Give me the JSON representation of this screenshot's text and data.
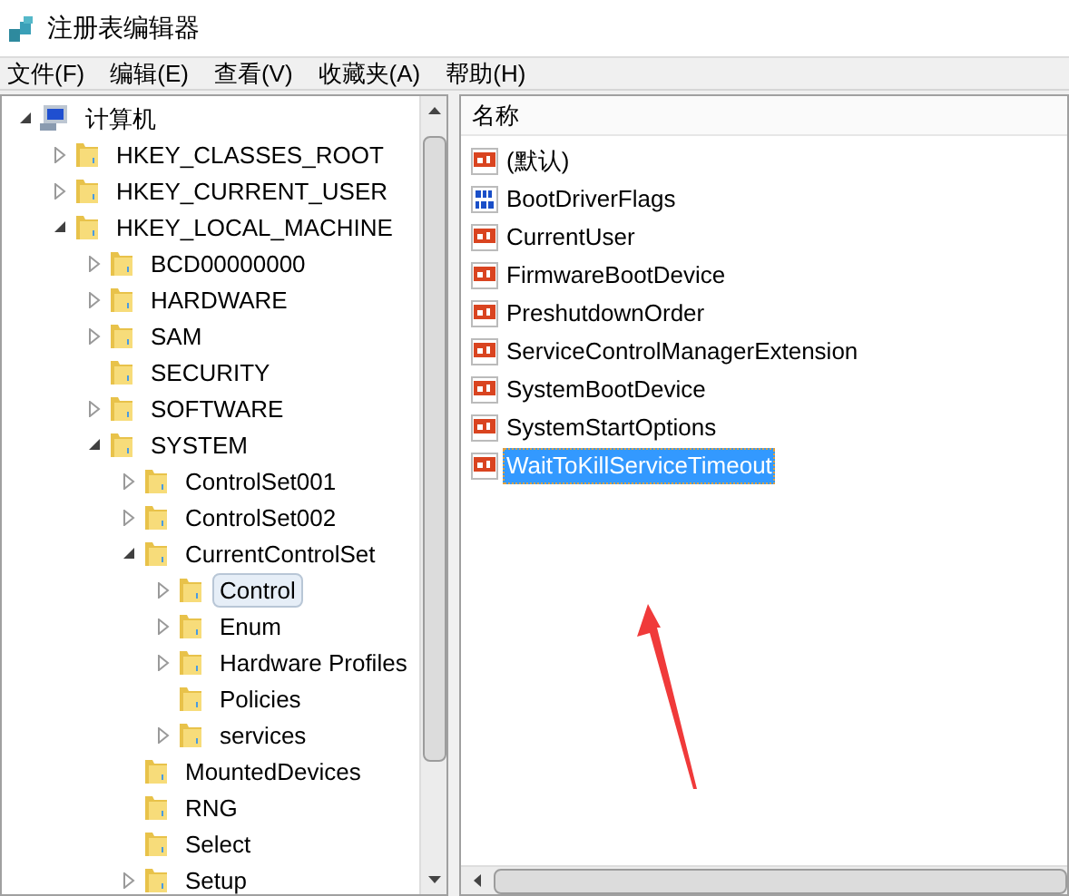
{
  "window": {
    "title": "注册表编辑器"
  },
  "menu": [
    "文件(F)",
    "编辑(E)",
    "查看(V)",
    "收藏夹(A)",
    "帮助(H)"
  ],
  "tree": {
    "label": "计算机",
    "expanded": true,
    "selected": false,
    "children": [
      {
        "label": "HKEY_CLASSES_ROOT",
        "expanded": false,
        "selected": false
      },
      {
        "label": "HKEY_CURRENT_USER",
        "expanded": false,
        "selected": false
      },
      {
        "label": "HKEY_LOCAL_MACHINE",
        "expanded": true,
        "selected": false,
        "children": [
          {
            "label": "BCD00000000",
            "expanded": false,
            "selected": false
          },
          {
            "label": "HARDWARE",
            "expanded": false,
            "selected": false
          },
          {
            "label": "SAM",
            "expanded": false,
            "selected": false
          },
          {
            "label": "SECURITY",
            "selected": false
          },
          {
            "label": "SOFTWARE",
            "expanded": false,
            "selected": false
          },
          {
            "label": "SYSTEM",
            "expanded": true,
            "selected": false,
            "children": [
              {
                "label": "ControlSet001",
                "expanded": false,
                "selected": false
              },
              {
                "label": "ControlSet002",
                "expanded": false,
                "selected": false
              },
              {
                "label": "CurrentControlSet",
                "expanded": true,
                "selected": false,
                "children": [
                  {
                    "label": "Control",
                    "expanded": false,
                    "selected": true
                  },
                  {
                    "label": "Enum",
                    "expanded": false,
                    "selected": false
                  },
                  {
                    "label": "Hardware Profiles",
                    "expanded": false,
                    "selected": false
                  },
                  {
                    "label": "Policies",
                    "selected": false
                  },
                  {
                    "label": "services",
                    "expanded": false,
                    "selected": false
                  }
                ]
              },
              {
                "label": "MountedDevices",
                "selected": false
              },
              {
                "label": "RNG",
                "selected": false
              },
              {
                "label": "Select",
                "selected": false
              },
              {
                "label": "Setup",
                "expanded": false,
                "selected": false
              }
            ]
          }
        ]
      }
    ]
  },
  "values": {
    "column": "名称",
    "rows": [
      {
        "name": "(默认)",
        "kind": "string",
        "selected": false
      },
      {
        "name": "BootDriverFlags",
        "kind": "binary",
        "selected": false
      },
      {
        "name": "CurrentUser",
        "kind": "string",
        "selected": false
      },
      {
        "name": "FirmwareBootDevice",
        "kind": "string",
        "selected": false
      },
      {
        "name": "PreshutdownOrder",
        "kind": "string",
        "selected": false
      },
      {
        "name": "ServiceControlManagerExtension",
        "kind": "string",
        "selected": false
      },
      {
        "name": "SystemBootDevice",
        "kind": "string",
        "selected": false
      },
      {
        "name": "SystemStartOptions",
        "kind": "string",
        "selected": false
      },
      {
        "name": "WaitToKillServiceTimeout",
        "kind": "string",
        "selected": true
      }
    ]
  }
}
